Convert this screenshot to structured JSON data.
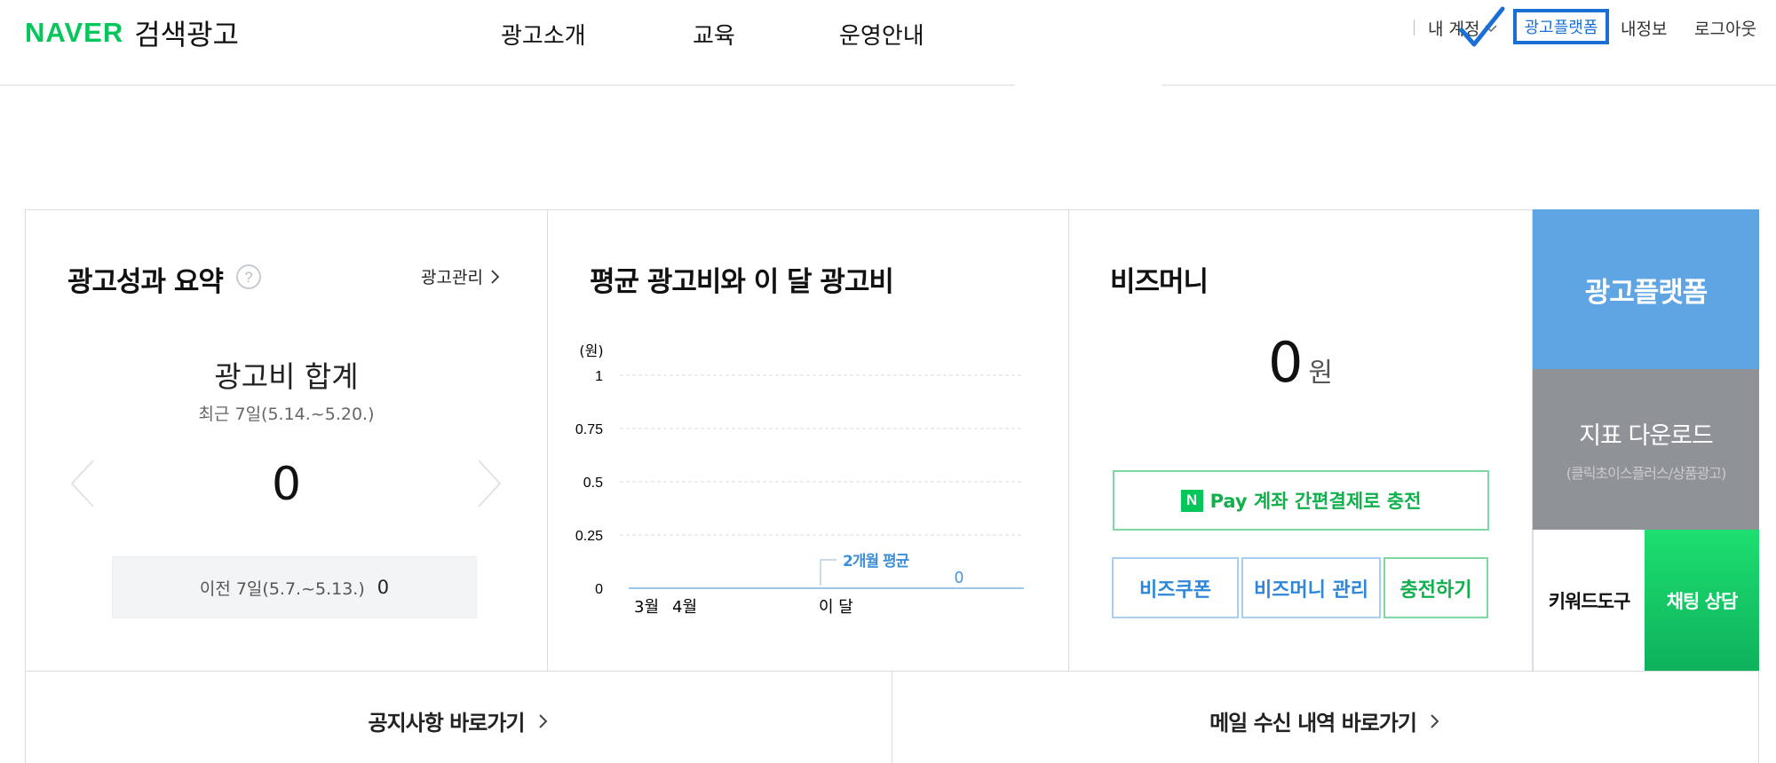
{
  "header": {
    "logo_brand": "NAVER",
    "logo_service": "검색광고",
    "nav": [
      "광고소개",
      "교육",
      "운영안내"
    ],
    "util": {
      "account": "내 계정",
      "ad_platform": "광고플랫폼",
      "my_info": "내정보",
      "logout": "로그아웃"
    }
  },
  "summary": {
    "title": "광고성과 요약",
    "manage_link": "광고관리",
    "cost_title": "광고비 합계",
    "period": "최근 7일(5.14.~5.20.)",
    "value": "0",
    "prev_label": "이전 7일(5.7.~5.13.)",
    "prev_value": "0"
  },
  "avg_chart": {
    "title": "평균 광고비와 이 달 광고비",
    "unit": "(원)",
    "avg_label": "2개월 평균",
    "current_label": "0"
  },
  "chart_data": {
    "type": "bar",
    "title": "평균 광고비와 이 달 광고비",
    "ylabel": "(원)",
    "ylim": [
      0,
      1
    ],
    "yticks": [
      "1",
      "0.75",
      "0.5",
      "0.25",
      "0"
    ],
    "categories": [
      "3월",
      "4월",
      "이 달"
    ],
    "values": [
      0,
      0,
      0
    ],
    "annotations": [
      "2개월 평균",
      "0"
    ],
    "grid": true
  },
  "bizmoney": {
    "title": "비즈머니",
    "amount": "0",
    "unit": "원",
    "npay_badge": "N",
    "npay_text": "Pay 계좌 간편결제로 충전",
    "coupon_btn": "비즈쿠폰",
    "manage_btn": "비즈머니 관리",
    "charge_btn": "충전하기"
  },
  "side": {
    "platform": "광고플랫폼",
    "download": "지표 다운로드",
    "download_sub": "(클릭초이스플러스/상품광고)",
    "keyword_tool": "키워드도구",
    "chat": "채팅 상담"
  },
  "footer_links": {
    "notice": "공지사항 바로가기",
    "mail": "메일 수신 내역 바로가기"
  },
  "colors": {
    "naver_green": "#03c75a",
    "platform_blue": "#5fa4e3",
    "download_gray": "#8f9296",
    "chat_green": "#12c365",
    "highlight_blue": "#1a6fd4"
  }
}
